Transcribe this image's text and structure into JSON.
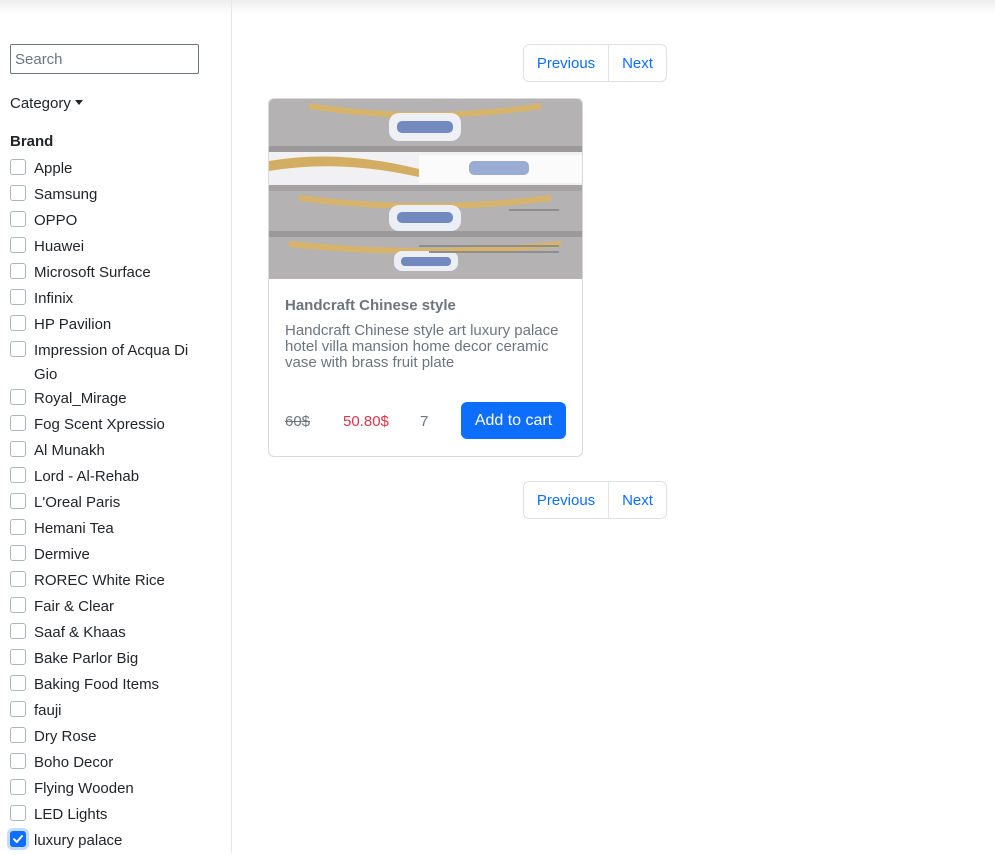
{
  "sidebar": {
    "search_placeholder": "Search",
    "category_label": "Category",
    "brand_title": "Brand",
    "brands": [
      {
        "label": "Apple",
        "checked": false
      },
      {
        "label": "Samsung",
        "checked": false
      },
      {
        "label": "OPPO",
        "checked": false
      },
      {
        "label": "Huawei",
        "checked": false
      },
      {
        "label": "Microsoft Surface",
        "checked": false
      },
      {
        "label": "Infinix",
        "checked": false
      },
      {
        "label": "HP Pavilion",
        "checked": false
      },
      {
        "label": "Impression of Acqua Di Gio",
        "checked": false
      },
      {
        "label": "Royal_Mirage",
        "checked": false
      },
      {
        "label": "Fog Scent Xpressio",
        "checked": false
      },
      {
        "label": "Al Munakh",
        "checked": false
      },
      {
        "label": "Lord - Al-Rehab",
        "checked": false
      },
      {
        "label": "L'Oreal Paris",
        "checked": false
      },
      {
        "label": "Hemani Tea",
        "checked": false
      },
      {
        "label": "Dermive",
        "checked": false
      },
      {
        "label": "ROREC White Rice",
        "checked": false
      },
      {
        "label": "Fair & Clear",
        "checked": false
      },
      {
        "label": "Saaf & Khaas",
        "checked": false
      },
      {
        "label": "Bake Parlor Big",
        "checked": false
      },
      {
        "label": "Baking Food Items",
        "checked": false
      },
      {
        "label": "fauji",
        "checked": false
      },
      {
        "label": "Dry Rose",
        "checked": false
      },
      {
        "label": "Boho Decor",
        "checked": false
      },
      {
        "label": "Flying Wooden",
        "checked": false
      },
      {
        "label": "LED Lights",
        "checked": false
      },
      {
        "label": "luxury palace",
        "checked": true
      }
    ]
  },
  "pagination": {
    "previous_label": "Previous",
    "next_label": "Next"
  },
  "product": {
    "title": "Handcraft Chinese style",
    "description": "Handcraft Chinese style art luxury palace hotel villa mansion home decor ceramic vase with brass fruit plate",
    "old_price": "60$",
    "price": "50.80$",
    "quantity": "7",
    "add_to_cart_label": "Add to cart"
  },
  "colors": {
    "primary": "#0d6efd",
    "sale_price": "#dc3545",
    "muted_text": "#6c757d"
  }
}
